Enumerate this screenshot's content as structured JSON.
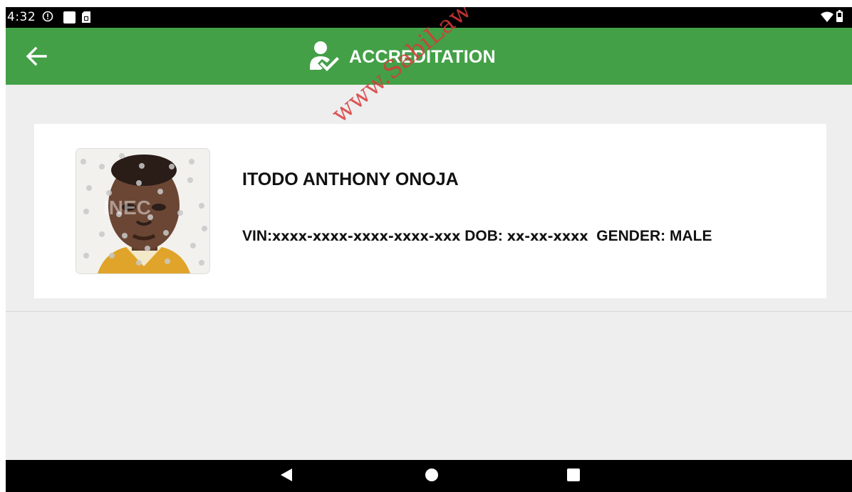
{
  "status_bar": {
    "time": "4:32",
    "icons": [
      "shield-alert-icon",
      "square-notification-icon",
      "sim-card-icon",
      "wifi-icon",
      "battery-icon"
    ]
  },
  "app_bar": {
    "title": "ACCREDITATION",
    "back_icon": "arrow-left-icon",
    "title_icon": "user-check-icon",
    "color": "#43a047"
  },
  "card": {
    "name": "ITODO ANTHONY ONOJA",
    "vin_label": "VIN:",
    "vin_value": "xxxx-xxxx-xxxx-xxxx-xxx",
    "dob_label": "DOB:",
    "dob_value": "xx-xx-xxxx",
    "gender_label": "GENDER:",
    "gender_value": "MALE"
  },
  "watermark": "www.SabiLaw",
  "nav_bar": {
    "icons": [
      "nav-back-icon",
      "nav-home-icon",
      "nav-recents-icon"
    ]
  }
}
